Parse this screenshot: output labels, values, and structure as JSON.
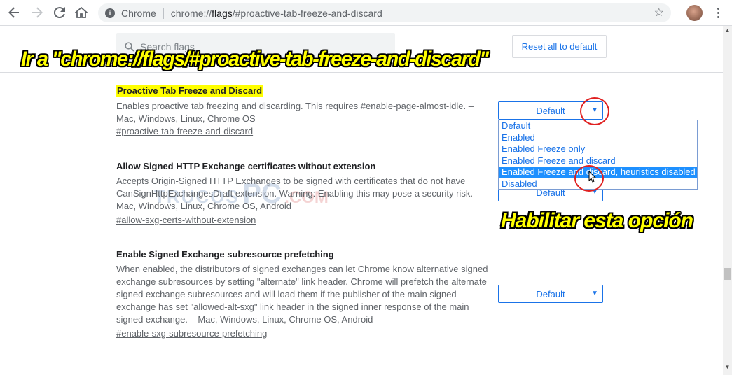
{
  "browser": {
    "chip": "Chrome",
    "url_scheme": "chrome://",
    "url_host": "flags",
    "url_path": "/#proactive-tab-freeze-and-discard"
  },
  "header": {
    "search_placeholder": "Search flags",
    "reset_label": "Reset all to default"
  },
  "flags": [
    {
      "title": "Proactive Tab Freeze and Discard",
      "desc_1": "Enables proactive tab freezing and discarding. This requires #enable-page-almost-idle. –",
      "desc_2": "Mac, Windows, Linux, Chrome OS",
      "link": "#proactive-tab-freeze-and-discard",
      "select_value": "Default"
    },
    {
      "title": "Allow Signed HTTP Exchange certificates without extension",
      "desc_1": "Accepts Origin-Signed HTTP Exchanges to be signed with certificates that do not have",
      "desc_2": "CanSignHttpExchangesDraft extension. Warning: Enabling this may pose a security risk. –",
      "desc_3": "Mac, Windows, Linux, Chrome OS, Android",
      "link": "#allow-sxg-certs-without-extension",
      "select_value": "Default"
    },
    {
      "title": "Enable Signed Exchange subresource prefetching",
      "desc_1": "When enabled, the distributors of signed exchanges can let Chrome know alternative signed",
      "desc_2": "exchange subresources by setting \"alternate\" link header. Chrome will prefetch the alternate",
      "desc_3": "signed exchange subresources and will load them if the publisher of the main signed",
      "desc_4": "exchange has set \"allowed-alt-sxg\" link header in the signed inner response of the main",
      "desc_5": "signed exchange. – Mac, Windows, Linux, Chrome OS, Android",
      "link": "#enable-sxg-subresource-prefetching",
      "select_value": "Default"
    }
  ],
  "dropdown": {
    "options": [
      "Default",
      "Enabled",
      "Enabled Freeze only",
      "Enabled Freeze and discard",
      "Enabled Freeze and discard, heuristics disabled",
      "Disabled"
    ],
    "highlighted_index": 4
  },
  "annotations": {
    "top": "Ir a \"chrome://flags/#proactive-tab-freeze-and-discard\"",
    "side": "Habilitar esta opción"
  },
  "watermark": {
    "line1": "TRUCOS",
    "line2": "PC",
    "line3": ".COM"
  },
  "colors": {
    "accent": "#1a73e8",
    "highlight": "#ffff00",
    "annotation_ring": "#e02020",
    "selected_option": "#1e90ff"
  }
}
